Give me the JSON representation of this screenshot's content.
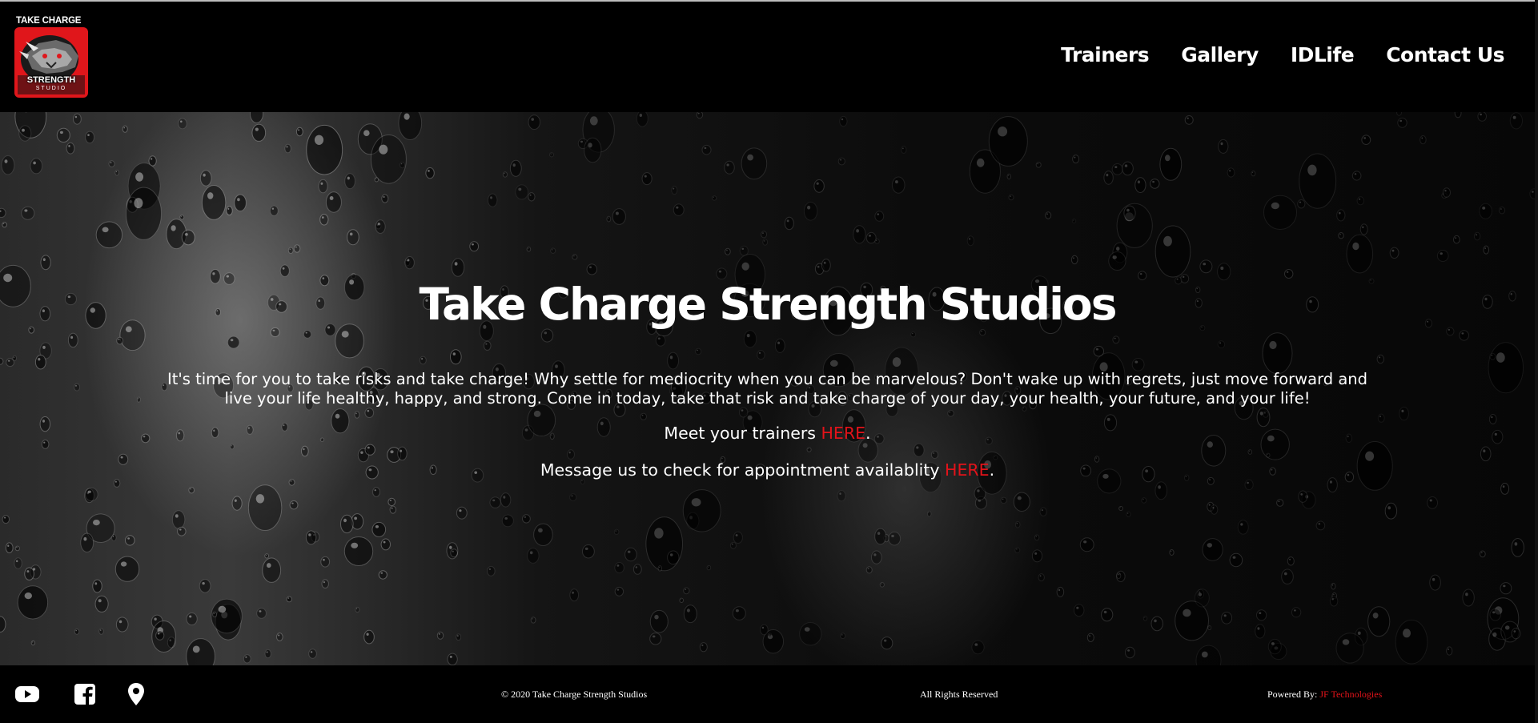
{
  "header": {
    "logo_top_bold": "TAKE CHARGE",
    "logo_strength": "STRENGTH",
    "logo_studio": "STUDIO",
    "nav": [
      {
        "label": "Trainers"
      },
      {
        "label": "Gallery"
      },
      {
        "label": "IDLife"
      },
      {
        "label": "Contact Us"
      }
    ]
  },
  "hero": {
    "title": "Take Charge Strength Studios",
    "paragraph": "It's time for you to take risks and take charge! Why settle for mediocrity when you can be marvelous? Don't wake up with regrets, just move forward and live your life healthy, happy, and strong. Come in today, take that risk and take charge of your day, your health, your future, and your life!",
    "trainers_text": "Meet your trainers ",
    "trainers_link": "HERE",
    "trainers_end": ".",
    "message_text": "Message us to check for appointment availablity ",
    "message_link": "HERE",
    "message_end": "."
  },
  "footer": {
    "social_icons": [
      "youtube-icon",
      "facebook-icon",
      "location-pin-icon"
    ],
    "copyright": "© 2020 Take Charge Strength Studios",
    "rights": "All Rights Reserved",
    "powered_by": "Powered By: ",
    "powered_link": "JF Technologies"
  },
  "colors": {
    "background": "#000000",
    "accent_red": "#e3131a",
    "text": "#ffffff"
  }
}
